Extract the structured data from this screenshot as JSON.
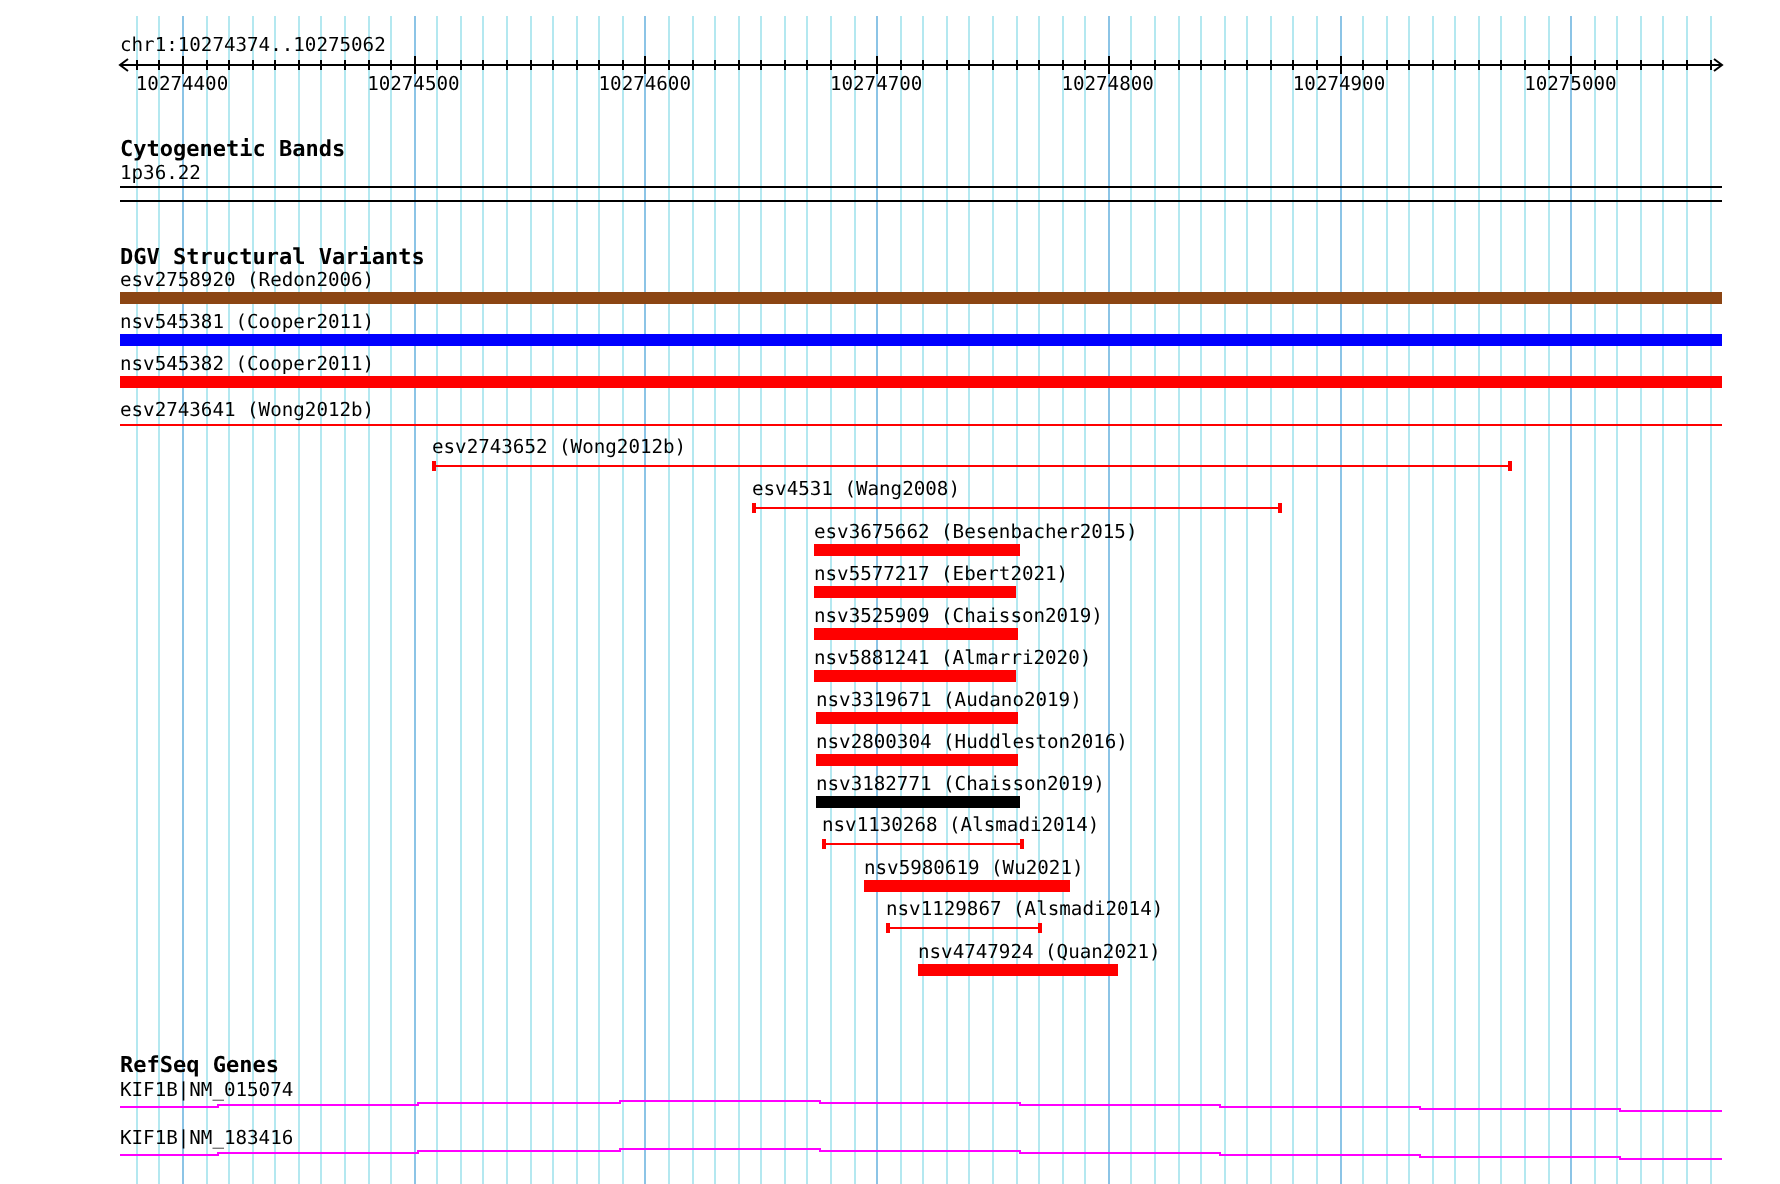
{
  "ruler": {
    "range": "chr1:10274374..10275062",
    "tick_labels": [
      "10274400",
      "10274500",
      "10274600",
      "10274700",
      "10274800",
      "10274900",
      "10275000"
    ]
  },
  "tracks": [
    {
      "title": "Cytogenetic Bands",
      "features": [
        {
          "label": "1p36.22",
          "kind": "band"
        }
      ]
    },
    {
      "title": "DGV Structural Variants",
      "features": [
        {
          "label": "esv2758920 (Redon2006)",
          "kind": "bar",
          "color": "#8b4513"
        },
        {
          "label": "nsv545381 (Cooper2011)",
          "kind": "bar",
          "color": "#0000ff"
        },
        {
          "label": "nsv545382 (Cooper2011)",
          "kind": "bar",
          "color": "#ff0000"
        },
        {
          "label": "esv2743641 (Wong2012b)",
          "kind": "line",
          "color": "#ff0000"
        },
        {
          "label": "esv2743652 (Wong2012b)",
          "kind": "span",
          "color": "#ff0000"
        },
        {
          "label": "esv4531 (Wang2008)",
          "kind": "span",
          "color": "#ff0000"
        },
        {
          "label": "esv3675662 (Besenbacher2015)",
          "kind": "bar",
          "color": "#ff0000"
        },
        {
          "label": "nsv5577217 (Ebert2021)",
          "kind": "bar",
          "color": "#ff0000"
        },
        {
          "label": "nsv3525909 (Chaisson2019)",
          "kind": "bar",
          "color": "#ff0000"
        },
        {
          "label": "nsv5881241 (Almarri2020)",
          "kind": "bar",
          "color": "#ff0000"
        },
        {
          "label": "nsv3319671 (Audano2019)",
          "kind": "bar",
          "color": "#ff0000"
        },
        {
          "label": "nsv2800304 (Huddleston2016)",
          "kind": "bar",
          "color": "#ff0000"
        },
        {
          "label": "nsv3182771 (Chaisson2019)",
          "kind": "bar",
          "color": "#000000"
        },
        {
          "label": "nsv1130268 (Alsmadi2014)",
          "kind": "span",
          "color": "#ff0000"
        },
        {
          "label": "nsv5980619 (Wu2021)",
          "kind": "bar",
          "color": "#ff0000"
        },
        {
          "label": "nsv1129867 (Alsmadi2014)",
          "kind": "span",
          "color": "#ff0000"
        },
        {
          "label": "nsv4747924 (Quan2021)",
          "kind": "bar",
          "color": "#ff0000"
        }
      ]
    },
    {
      "title": "RefSeq Genes",
      "features": [
        {
          "label": "KIF1B|NM_015074",
          "kind": "gene"
        },
        {
          "label": "KIF1B|NM_183416",
          "kind": "gene"
        }
      ]
    }
  ]
}
